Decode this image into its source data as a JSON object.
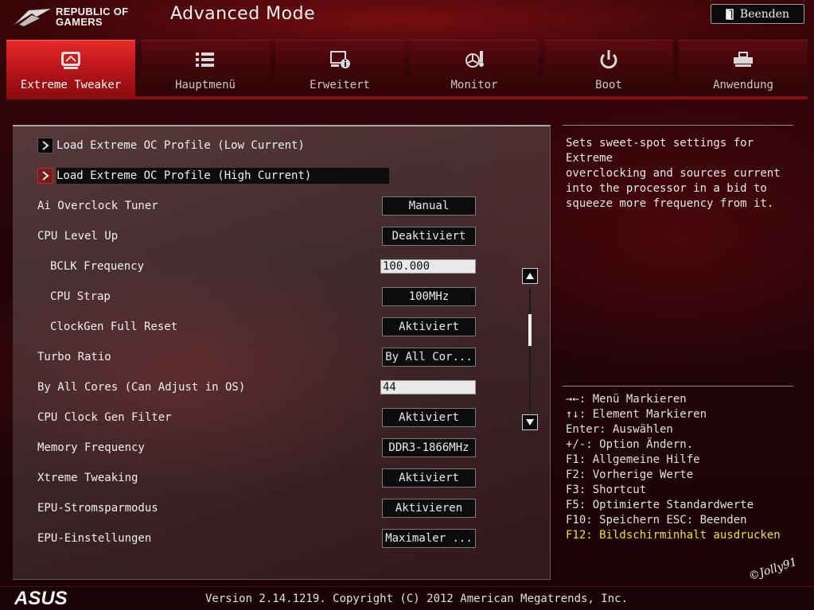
{
  "header": {
    "brand_line1": "REPUBLIC OF",
    "brand_line2": "GAMERS",
    "mode_title": "Advanced Mode",
    "exit_label": "Beenden"
  },
  "tabs": [
    {
      "label": "Extreme Tweaker",
      "icon": "extreme-tweaker-icon",
      "active": true
    },
    {
      "label": "Hauptmenü",
      "icon": "list-icon",
      "active": false
    },
    {
      "label": "Erweitert",
      "icon": "advanced-info-icon",
      "active": false
    },
    {
      "label": "Monitor",
      "icon": "monitor-fan-icon",
      "active": false
    },
    {
      "label": "Boot",
      "icon": "power-icon",
      "active": false
    },
    {
      "label": "Anwendung",
      "icon": "tool-icon",
      "active": false
    }
  ],
  "settings": {
    "profile_low": "Load Extreme OC Profile (Low Current)",
    "profile_high": "Load Extreme OC Profile (High Current)",
    "items": [
      {
        "label": "Ai Overclock Tuner",
        "value": "Manual",
        "kind": "button"
      },
      {
        "label": "CPU Level Up",
        "value": "Deaktiviert",
        "kind": "button"
      },
      {
        "label": "BCLK Frequency",
        "value": "100.000",
        "kind": "input"
      },
      {
        "label": "CPU Strap",
        "value": "100MHz",
        "kind": "button"
      },
      {
        "label": "ClockGen Full Reset",
        "value": "Aktiviert",
        "kind": "button"
      },
      {
        "label": "Turbo Ratio",
        "value": "By All Cor...",
        "kind": "button"
      },
      {
        "label": "By All Cores (Can Adjust in OS)",
        "value": "44",
        "kind": "input"
      },
      {
        "label": "CPU Clock Gen Filter",
        "value": "Aktiviert",
        "kind": "button"
      },
      {
        "label": "Memory Frequency",
        "value": "DDR3-1866MHz",
        "kind": "button"
      },
      {
        "label": "Xtreme Tweaking",
        "value": "Aktiviert",
        "kind": "button"
      },
      {
        "label": "EPU-Stromsparmodus",
        "value": "Aktivieren",
        "kind": "button"
      },
      {
        "label": "EPU-Einstellungen",
        "value": "Maximaler ...",
        "kind": "button"
      }
    ]
  },
  "help": {
    "lines": [
      "Sets sweet-spot settings for Extreme",
      "overclocking and sources current",
      "into the processor in a bid to",
      "squeeze more frequency from it."
    ]
  },
  "keys": [
    "→←: Menü Markieren",
    "↑↓: Element Markieren",
    "Enter: Auswählen",
    "+/-: Option Ändern.",
    "F1: Allgemeine Hilfe",
    "F2: Vorherige Werte",
    "F3: Shortcut",
    "F5: Optimierte Standardwerte",
    "F10: Speichern  ESC: Beenden",
    "F12: Bildschirminhalt ausdrucken"
  ],
  "watermark": "©Jolly91",
  "footer": {
    "brand": "ASUS",
    "version": "Version 2.14.1219. Copyright (C) 2012 American Megatrends, Inc."
  },
  "colors": {
    "accent_red": "#b8141a",
    "highlight_yellow": "#f0e02a"
  }
}
